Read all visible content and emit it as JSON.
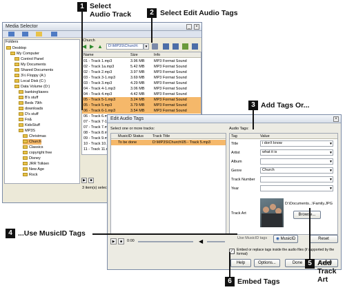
{
  "callouts": {
    "c1_num": "1",
    "c1_text": "Select Audio Track",
    "c2_num": "2",
    "c2_text": "Select Edit Audio Tags",
    "c3_num": "3",
    "c3_text": "Add Tags Or...",
    "c4_num": "4",
    "c4_text": "...Use MusicID Tags",
    "c5_num": "5",
    "c5_text": "Add Track Art",
    "c6_num": "6",
    "c6_text": "Embed Tags"
  },
  "media_selector": {
    "title": "Media Selector",
    "folders_label": "Folders",
    "tree": [
      {
        "label": "Desktop",
        "indent": 0
      },
      {
        "label": "My Computer",
        "indent": 1
      },
      {
        "label": "Control Panel",
        "indent": 2
      },
      {
        "label": "My Documents",
        "indent": 2
      },
      {
        "label": "Shared Documents",
        "indent": 2
      },
      {
        "label": "3½ Floppy (A:)",
        "indent": 2
      },
      {
        "label": "Local Disk (C:)",
        "indent": 2
      },
      {
        "label": "Data Volume (D:)",
        "indent": 2
      },
      {
        "label": "banking\\taxes",
        "indent": 3
      },
      {
        "label": "B's stuff",
        "indent": 3
      },
      {
        "label": "Beds 79th",
        "indent": 3
      },
      {
        "label": "downloads",
        "indent": 3
      },
      {
        "label": "D's stuff",
        "indent": 3
      },
      {
        "label": "Fn&",
        "indent": 3
      },
      {
        "label": "KidsStuff",
        "indent": 3
      },
      {
        "label": "MP3S",
        "indent": 3
      },
      {
        "label": "Christmas",
        "indent": 4
      },
      {
        "label": "Church",
        "indent": 4
      },
      {
        "label": "Classics",
        "indent": 4
      },
      {
        "label": "copyright free",
        "indent": 4
      },
      {
        "label": "Disney",
        "indent": 4
      },
      {
        "label": "JRR Tolkien",
        "indent": 4
      },
      {
        "label": "New Age",
        "indent": 4
      },
      {
        "label": "Rock",
        "indent": 4
      }
    ],
    "path_label": "Church",
    "path_value": "D:\\MP3S\\Church\\",
    "columns": {
      "name": "Name",
      "size": "Size",
      "info": "Info"
    },
    "files": [
      {
        "name": "01 - Track 1.mp3",
        "size": "3.96 MB",
        "info": "MP3 Format Sound",
        "selected": false
      },
      {
        "name": "02 - Track 1a.mp3",
        "size": "5.42 MB",
        "info": "MP3 Format Sound",
        "selected": false
      },
      {
        "name": "02 - Track 2.mp3",
        "size": "3.97 MB",
        "info": "MP3 Format Sound",
        "selected": false
      },
      {
        "name": "03 - Track 3-1.mp3",
        "size": "3.69 MB",
        "info": "MP3 Format Sound",
        "selected": false
      },
      {
        "name": "03 - Track 3.mp3",
        "size": "4.29 MB",
        "info": "MP3 Format Sound",
        "selected": false
      },
      {
        "name": "04 - Track 4-1.mp3",
        "size": "3.06 MB",
        "info": "MP3 Format Sound",
        "selected": false
      },
      {
        "name": "04 - Track 4.mp3",
        "size": "4.42 MB",
        "info": "MP3 Format Sound",
        "selected": false
      },
      {
        "name": "05 - Track 5-1.mp3",
        "size": "3.24 MB",
        "info": "MP3 Format Sound",
        "selected": true
      },
      {
        "name": "05 - Track 5.mp3",
        "size": "3.79 MB",
        "info": "MP3 Format Sound",
        "selected": true
      },
      {
        "name": "06 - Track 6-1.mp3",
        "size": "3.54 MB",
        "info": "MP3 Format Sound",
        "selected": true
      },
      {
        "name": "06 - Track 6.mp3",
        "size": "",
        "info": "",
        "selected": false
      },
      {
        "name": "07 - Track 7-1.mp3",
        "size": "",
        "info": "",
        "selected": false
      },
      {
        "name": "07 - Track 7.mp3",
        "size": "",
        "info": "",
        "selected": false
      },
      {
        "name": "08 - Track 8.mp3",
        "size": "",
        "info": "",
        "selected": false
      },
      {
        "name": "09 - Track 9.mp3",
        "size": "",
        "info": "",
        "selected": false
      },
      {
        "name": "10 - Track 10.mp3",
        "size": "",
        "info": "",
        "selected": false
      },
      {
        "name": "11 - Track 11.mp3",
        "size": "",
        "info": "",
        "selected": false
      }
    ],
    "status": "3 item(s) selected"
  },
  "edit_dialog": {
    "title": "Edit Audio Tags",
    "left_heading": "Select one or more tracks:",
    "track_columns": {
      "status": "MusicID Status",
      "title": "Track Title"
    },
    "track_row": {
      "status": "To be done",
      "title": "D:\\MP3S\\Church\\05 - Track 5.mp3"
    },
    "right_heading": "Audio Tags:",
    "tag_columns": {
      "tag": "Tag",
      "value": "Value"
    },
    "tags": [
      {
        "tag": "Title",
        "value": "i don't know"
      },
      {
        "tag": "Artist",
        "value": "what it is"
      },
      {
        "tag": "Album",
        "value": ""
      },
      {
        "tag": "Genre",
        "value": "Church"
      },
      {
        "tag": "Track Number",
        "value": ""
      },
      {
        "tag": "Year",
        "value": ""
      }
    ],
    "track_art_label": "Track Art",
    "art_path": "D:\\Documents...\\Family.JPG",
    "browse_label": "Browse...",
    "use_musicid_label": "Use MusicID tags",
    "musicid_button": "MusicID",
    "reset_button": "Reset",
    "time": "0:00",
    "embed_label": "Embed or replace tags inside the audio files (if supported by the format)",
    "help_button": "Help",
    "options_button": "Options...",
    "done_button": "Done",
    "cancel_button": "Cancel"
  }
}
